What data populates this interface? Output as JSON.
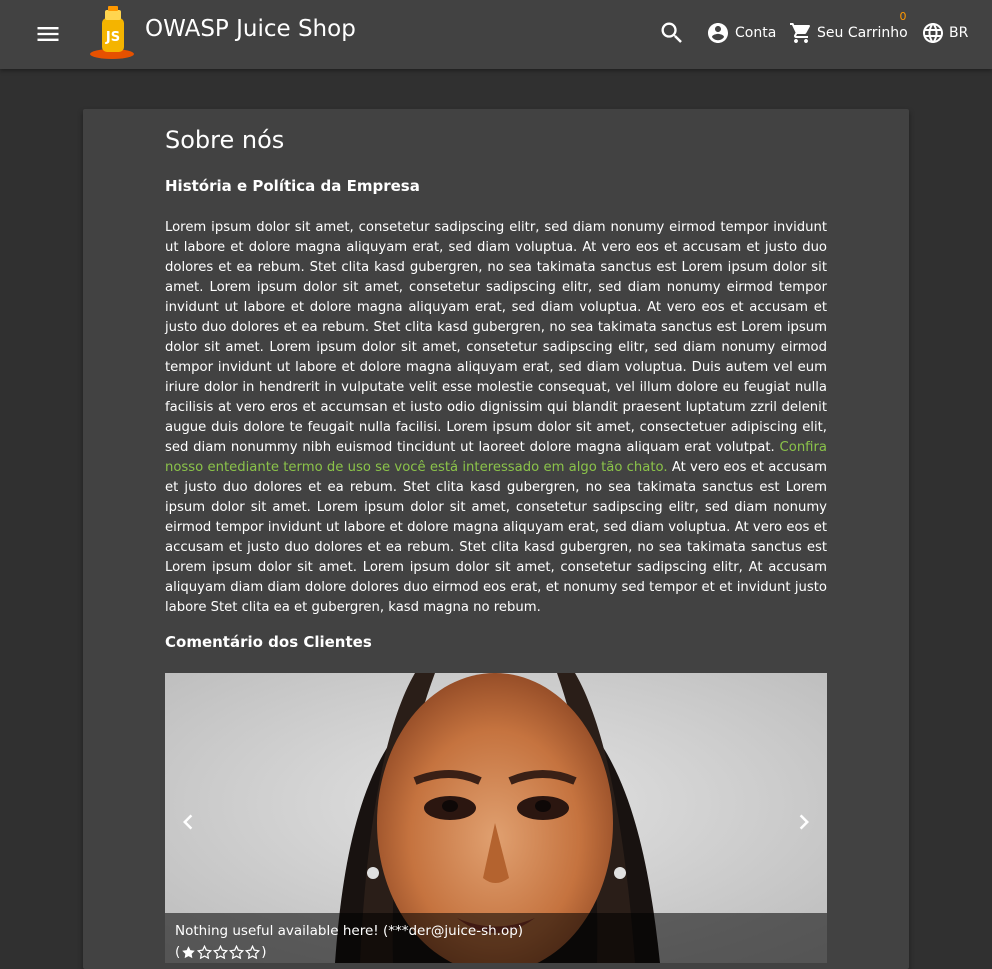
{
  "header": {
    "app_title": "OWASP Juice Shop",
    "account_label": "Conta",
    "cart_label": "Seu Carrinho",
    "cart_count": "0",
    "language_label": "BR",
    "icons": [
      "menu-icon",
      "juice-shop-logo",
      "search-icon",
      "account-circle-icon",
      "shopping-cart-icon",
      "language-icon"
    ]
  },
  "page": {
    "title": "Sobre nós",
    "history_heading": "História e Política da Empresa",
    "body_before_link": "Lorem ipsum dolor sit amet, consetetur sadipscing elitr, sed diam nonumy eirmod tempor invidunt ut labore et dolore magna aliquyam erat, sed diam voluptua. At vero eos et accusam et justo duo dolores et ea rebum. Stet clita kasd gubergren, no sea takimata sanctus est Lorem ipsum dolor sit amet. Lorem ipsum dolor sit amet, consetetur sadipscing elitr, sed diam nonumy eirmod tempor invidunt ut labore et dolore magna aliquyam erat, sed diam voluptua. At vero eos et accusam et justo duo dolores et ea rebum. Stet clita kasd gubergren, no sea takimata sanctus est Lorem ipsum dolor sit amet. Lorem ipsum dolor sit amet, consetetur sadipscing elitr, sed diam nonumy eirmod tempor invidunt ut labore et dolore magna aliquyam erat, sed diam voluptua. Duis autem vel eum iriure dolor in hendrerit in vulputate velit esse molestie consequat, vel illum dolore eu feugiat nulla facilisis at vero eros et accumsan et iusto odio dignissim qui blandit praesent luptatum zzril delenit augue duis dolore te feugait nulla facilisi. Lorem ipsum dolor sit amet, consectetuer adipiscing elit, sed diam nonummy nibh euismod tincidunt ut laoreet dolore magna aliquam erat volutpat. ",
    "terms_link": "Confira nosso entediante termo de uso se você está interessado em algo tão chato.",
    "body_after_link": " At vero eos et accusam et justo duo dolores et ea rebum. Stet clita kasd gubergren, no sea takimata sanctus est Lorem ipsum dolor sit amet. Lorem ipsum dolor sit amet, consetetur sadipscing elitr, sed diam nonumy eirmod tempor invidunt ut labore et dolore magna aliquyam erat, sed diam voluptua. At vero eos et accusam et justo duo dolores et ea rebum. Stet clita kasd gubergren, no sea takimata sanctus est Lorem ipsum dolor sit amet. Lorem ipsum dolor sit amet, consetetur sadipscing elitr, At accusam aliquyam diam diam dolore dolores duo eirmod eos erat, et nonumy sed tempor et et invidunt justo labore Stet clita ea et gubergren, kasd magna no rebum.",
    "feedback_heading": "Comentário dos Clientes"
  },
  "carousel": {
    "caption": "Nothing useful available here! (***der@juice-sh.op)",
    "rating_open": "(",
    "rating_close": ")",
    "rating": 1,
    "rating_max": 5,
    "icons": [
      "chevron-left-icon",
      "chevron-right-icon",
      "star-icon"
    ]
  },
  "colors": {
    "toolbar": "#424242",
    "background": "#303030",
    "card": "#424242",
    "link": "#8bc34a",
    "badge": "#ff9800"
  }
}
